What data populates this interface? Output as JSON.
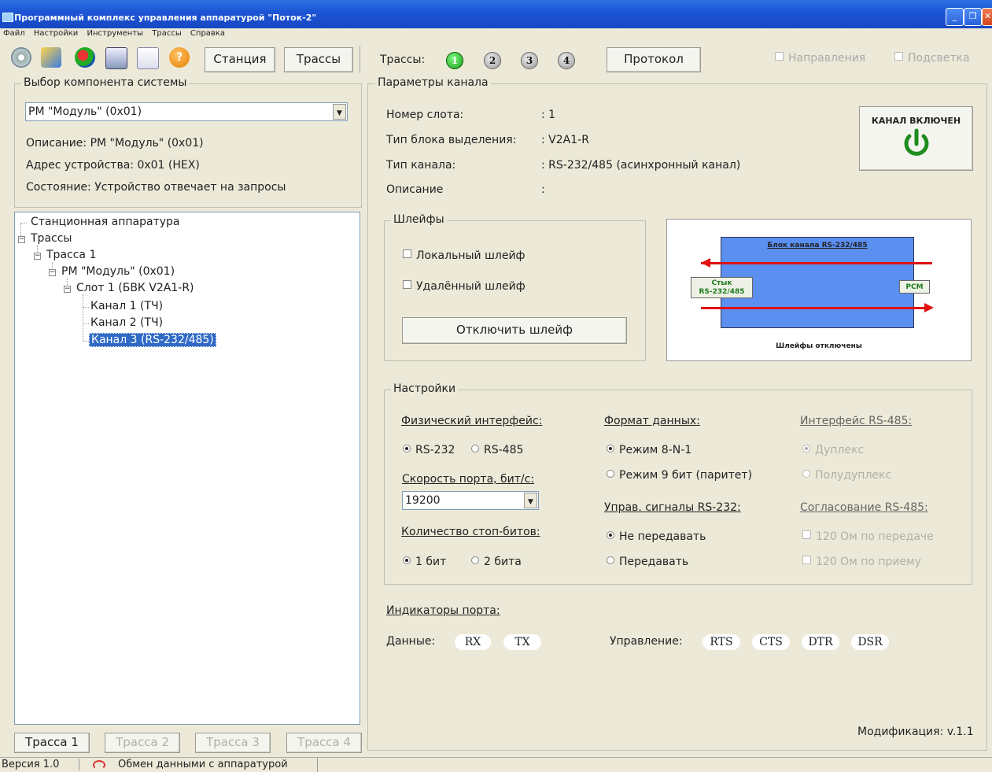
{
  "window": {
    "title": "Программный комплекс управления аппаратурой \"Поток-2\""
  },
  "menu": [
    "Файл",
    "Настройки",
    "Инструменты",
    "Трассы",
    "Справка"
  ],
  "toolbar": {
    "station_label": "Станция",
    "tracks_label": "Трассы",
    "tracks_prefix": "Трассы:",
    "track_numbers": [
      "1",
      "2",
      "3",
      "4"
    ],
    "protocol_label": "Протокол",
    "directions_label": "Направления",
    "highlight_label": "Подсветка"
  },
  "component": {
    "legend": "Выбор компонента системы",
    "selected": "РМ \"Модуль\" (0x01)",
    "description": "Описание:  РМ \"Модуль\" (0x01)",
    "address": "Адрес устройства:  0x01 (HEX)",
    "state": "Состояние:  Устройство отвечает на запросы"
  },
  "tree": {
    "station": "Станционная аппаратура",
    "tracks": "Трассы",
    "track1": "Трасса 1",
    "module": "РМ \"Модуль\" (0x01)",
    "slot": "Слот 1 (БВК V2A1-R)",
    "channel1": "Канал 1 (ТЧ)",
    "channel2": "Канал 2 (ТЧ)",
    "channel3": "Канал 3 (RS-232/485)"
  },
  "bottom_tabs": [
    "Трасса 1",
    "Трасса 2",
    "Трасса 3",
    "Трасса 4"
  ],
  "channel": {
    "legend": "Параметры канала",
    "slot_label": "Номер слота:",
    "slot_value": ":  1",
    "block_label": "Тип блока выделения:",
    "block_value": ":  V2A1-R",
    "type_label": "Тип канала:",
    "type_value": ":  RS-232/485 (асинхронный канал)",
    "desc_label": "Описание",
    "desc_value": ":",
    "power_label": "КАНАЛ ВКЛЮЧЕН"
  },
  "loops": {
    "legend": "Шлейфы",
    "local": "Локальный шлейф",
    "remote": "Удалённый шлейф",
    "disable_button": "Отключить шлейф"
  },
  "diagram": {
    "block_title": "Блок канала RS-232/485",
    "left_box_l1": "Стык",
    "left_box_l2": "RS-232/485",
    "right_box": "PCM",
    "caption": "Шлейфы отключены"
  },
  "settings": {
    "legend": "Настройки",
    "phys_label": "Физический интерфейс:",
    "rs232": "RS-232",
    "rs485": "RS-485",
    "speed_label": "Скорость порта, бит/с:",
    "speed_value": "19200",
    "stopbits_label": "Количество стоп-битов:",
    "stop1": "1 бит",
    "stop2": "2 бита",
    "format_label": "Формат данных:",
    "mode8": "Режим 8-N-1",
    "mode9": "Режим 9 бит (паритет)",
    "ctrl_label": "Управ. сигналы RS-232:",
    "no_send": "Не передавать",
    "send": "Передавать",
    "rs485_label": "Интерфейс RS-485:",
    "duplex": "Дуплекс",
    "halfduplex": "Полудуплекс",
    "match_label": "Согласование RS-485:",
    "tx120": "120 Ом по передаче",
    "rx120": "120 Ом по приему"
  },
  "indicators": {
    "title": "Индикаторы порта:",
    "data_label": "Данные:",
    "data": [
      "RX",
      "TX"
    ],
    "control_label": "Управление:",
    "control": [
      "RTS",
      "CTS",
      "DTR",
      "DSR"
    ]
  },
  "modification": "Модификация:  v.1.1",
  "status": {
    "version": "Версия 1.0",
    "exchange": "Обмен данными с аппаратурой"
  },
  "colors": {
    "accent_green": "#1e8c1e",
    "block_blue": "#5b8ff0",
    "arrow_red": "#e01010",
    "selection": "#316ac5"
  }
}
